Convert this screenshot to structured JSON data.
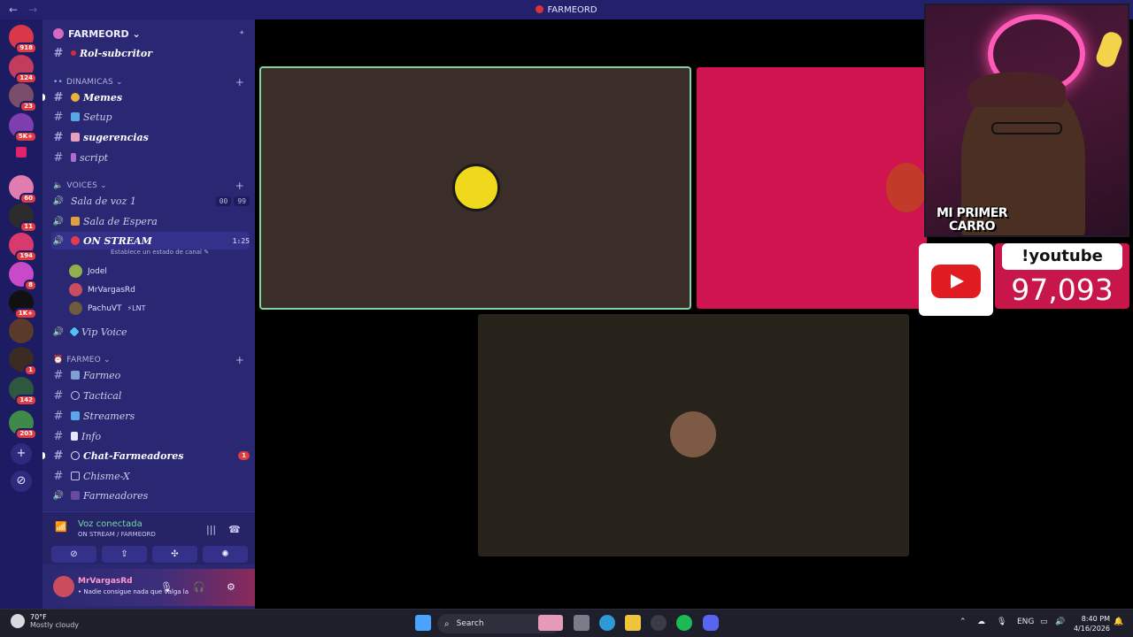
{
  "window": {
    "title": "FARMEORD",
    "nav_back": "←",
    "nav_forward": "→"
  },
  "servers": {
    "badges": [
      "918",
      "124",
      "23",
      "5K+",
      "60",
      "11",
      "194",
      "8",
      "1K+",
      "1",
      "142",
      "203"
    ],
    "add_glyph": "+",
    "explore_glyph": "⊘"
  },
  "guild": {
    "name": "FARMEORD ⌄",
    "invite_glyph": "⁺"
  },
  "sidebar": {
    "top_channel": "Rol-subcritor",
    "categories": {
      "dinamicas": "DINAMICAS ⌄",
      "voices": "VOICES ⌄",
      "farmeo": "FARMEO ⌄"
    },
    "dinamicas_channels": [
      "Memes",
      "Setup",
      "sugerencias",
      "script"
    ],
    "voice_channels": {
      "sala_voz": "Sala de voz 1",
      "sala_voz_counts": [
        "00",
        "99"
      ],
      "sala_espera": "Sala de Espera",
      "on_stream": "ON STREAM",
      "on_stream_time": "1:25",
      "status_hint": "Establece un estado de canal ✎",
      "vip_voice": "Vip Voice"
    },
    "members": [
      {
        "name": "Jodel",
        "tag": "",
        "color": "#8fb04a"
      },
      {
        "name": "MrVargasRd",
        "tag": "",
        "color": "#c94d5d"
      },
      {
        "name": "PachuVT",
        "tag": "⚡LNT",
        "color": "#6e5a3c"
      }
    ],
    "farmeo_channels": [
      "Farmeo",
      "Tactical",
      "Streamers",
      "Info",
      "Chat-Farmeadores",
      "Chisme-X",
      "Farmeadores"
    ],
    "chat_mentions": "1"
  },
  "voice_panel": {
    "title": "Voz conectada",
    "subtitle": "ON STREAM / FARMEORD",
    "buttons": [
      "⊘",
      "⇪",
      "✣",
      "✺"
    ]
  },
  "user_panel": {
    "username": "MrVargasRd",
    "status": "• Nadie consigue nada que valga la"
  },
  "stream": {
    "participant_colors": {
      "tile1": "#3b2e28",
      "tile2": "#cf1450",
      "tile3": "#27231a",
      "speaking_border": "#7ed6a3"
    },
    "overlay_caption_line1": "MI PRIMER",
    "overlay_caption_line2": "CARRO",
    "youtube_label": "!youtube",
    "youtube_count": "97,093"
  },
  "taskbar": {
    "weather_temp": "70°F",
    "weather_desc": "Mostly cloudy",
    "search_placeholder": "Search",
    "language": "ENG",
    "time": "8:40 PM",
    "date": "4/16/2026"
  }
}
